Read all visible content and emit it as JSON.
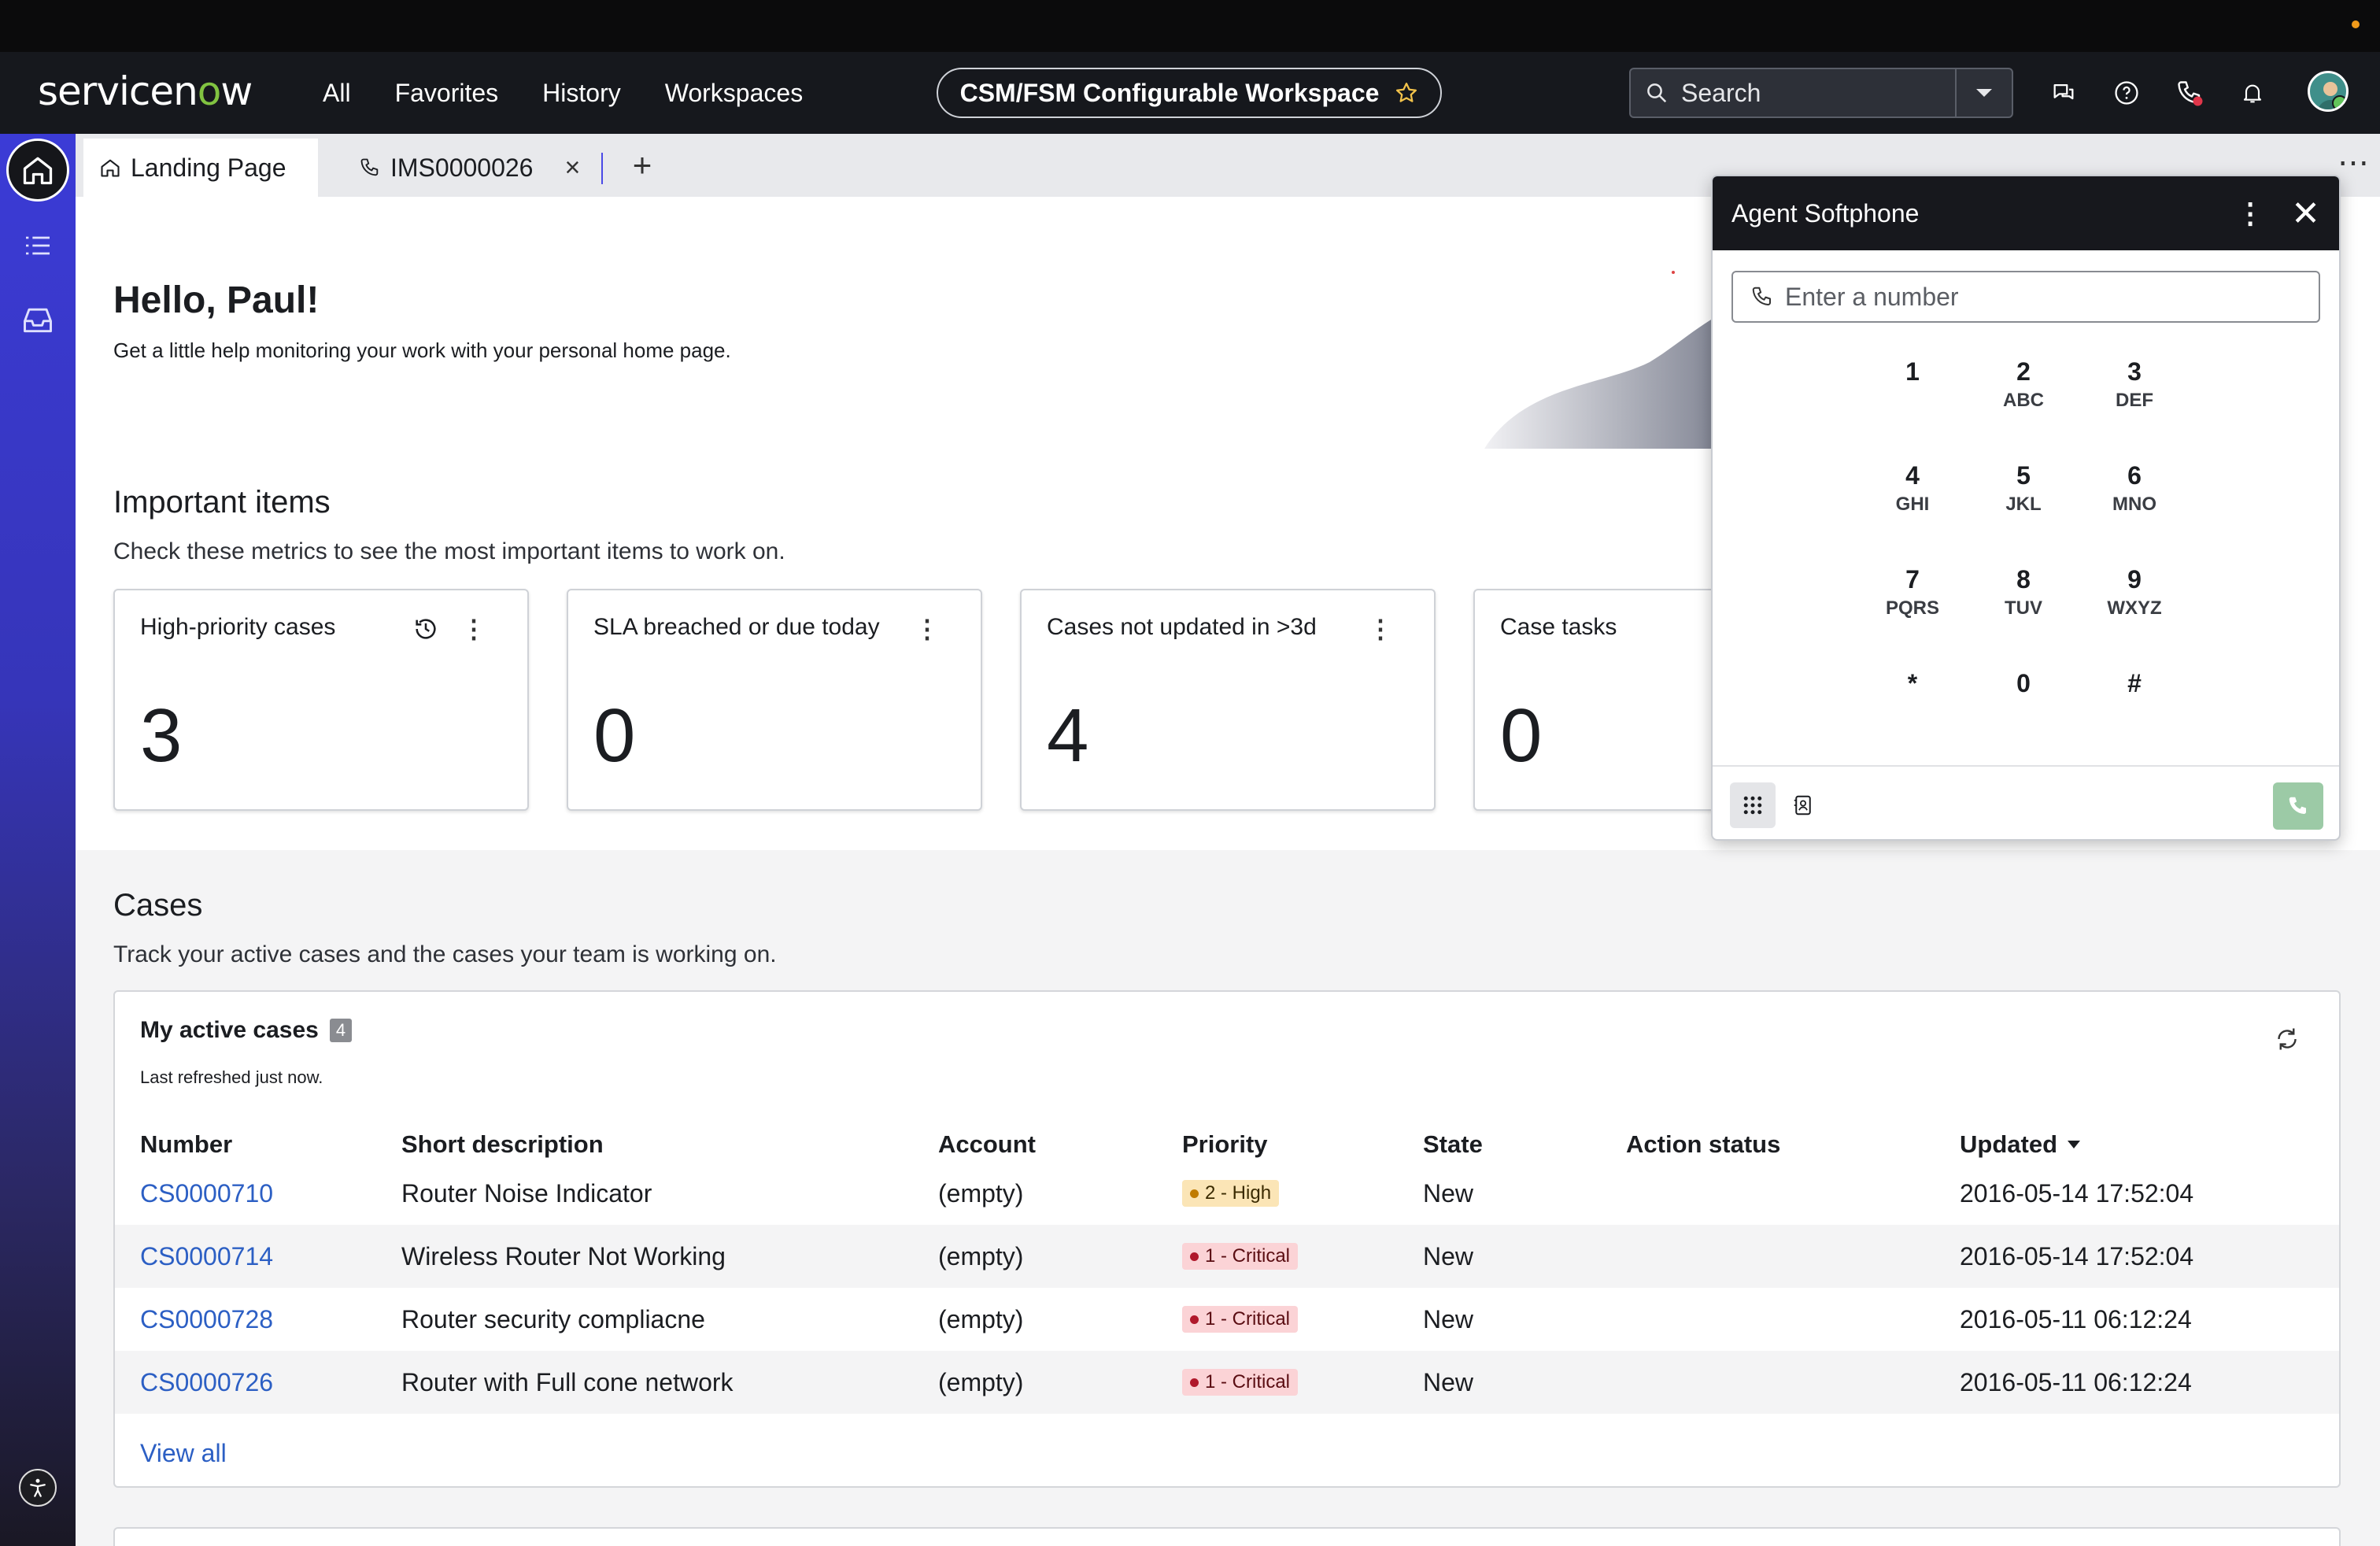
{
  "header": {
    "logo_text": "servicenow",
    "nav": [
      "All",
      "Favorites",
      "History",
      "Workspaces"
    ],
    "workspace_title": "CSM/FSM Configurable Workspace",
    "search_placeholder": "Search"
  },
  "tabs": [
    {
      "label": "Landing Page",
      "icon": "home-icon"
    },
    {
      "label": "IMS0000026",
      "icon": "phone-icon"
    }
  ],
  "hero": {
    "greeting": "Hello, Paul!",
    "subtitle": "Get a little help monitoring your work with your personal home page."
  },
  "important": {
    "title": "Important items",
    "subtitle": "Check these metrics to see the most important items to work on.",
    "metrics": [
      {
        "label": "High-priority cases",
        "value": "3"
      },
      {
        "label": "SLA breached or due today",
        "value": "0"
      },
      {
        "label": "Cases not updated in >3d",
        "value": "4"
      },
      {
        "label": "Case tasks",
        "value": "0"
      }
    ]
  },
  "cases": {
    "title": "Cases",
    "subtitle": "Track your active cases and the cases your team is working on.",
    "card_title": "My active cases",
    "card_count": "4",
    "refreshed": "Last refreshed just now.",
    "columns": [
      "Number",
      "Short description",
      "Account",
      "Priority",
      "State",
      "Action status",
      "Updated"
    ],
    "rows": [
      {
        "number": "CS0000710",
        "desc": "Router Noise Indicator",
        "account": "(empty)",
        "priority": "2 - High",
        "state": "New",
        "action": "",
        "updated": "2016-05-14 17:52:04"
      },
      {
        "number": "CS0000714",
        "desc": "Wireless Router Not Working",
        "account": "(empty)",
        "priority": "1 - Critical",
        "state": "New",
        "action": "",
        "updated": "2016-05-14 17:52:04"
      },
      {
        "number": "CS0000728",
        "desc": "Router security compliacne",
        "account": "(empty)",
        "priority": "1 - Critical",
        "state": "New",
        "action": "",
        "updated": "2016-05-11 06:12:24"
      },
      {
        "number": "CS0000726",
        "desc": "Router with Full cone network",
        "account": "(empty)",
        "priority": "1 - Critical",
        "state": "New",
        "action": "",
        "updated": "2016-05-11 06:12:24"
      }
    ],
    "view_all": "View all"
  },
  "softphone": {
    "title": "Agent Softphone",
    "placeholder": "Enter a number",
    "keys": [
      {
        "n": "1",
        "l": ""
      },
      {
        "n": "2",
        "l": "ABC"
      },
      {
        "n": "3",
        "l": "DEF"
      },
      {
        "n": "4",
        "l": "GHI"
      },
      {
        "n": "5",
        "l": "JKL"
      },
      {
        "n": "6",
        "l": "MNO"
      },
      {
        "n": "7",
        "l": "PQRS"
      },
      {
        "n": "8",
        "l": "TUV"
      },
      {
        "n": "9",
        "l": "WXYZ"
      },
      {
        "n": "*",
        "l": ""
      },
      {
        "n": "0",
        "l": ""
      },
      {
        "n": "#",
        "l": ""
      }
    ]
  },
  "colors": {
    "brand_green": "#81c341",
    "sidebar": "#3b3bd6",
    "link": "#2c5fc4",
    "critical": "#b0182b",
    "high": "#c07b00"
  }
}
